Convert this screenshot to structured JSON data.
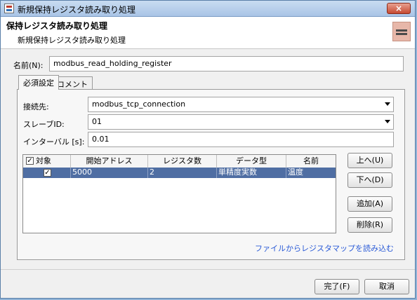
{
  "window": {
    "title": "新規保持レジスタ読み取り処理",
    "close_label": "×"
  },
  "header": {
    "title": "保持レジスタ読み取り処理",
    "subtitle": "新規保持レジスタ読み取り処理",
    "icon": "register-icon"
  },
  "name_field": {
    "label": "名前(N):",
    "value": "modbus_read_holding_register"
  },
  "tabs": [
    {
      "label": "必須設定",
      "selected": true
    },
    {
      "label": "コメント",
      "selected": false
    }
  ],
  "form": {
    "connection": {
      "label": "接続先:",
      "value": "modbus_tcp_connection"
    },
    "slave_id": {
      "label": "スレーブID:",
      "value": "01"
    },
    "interval": {
      "label": "インターバル [s]:",
      "value": "0.01"
    }
  },
  "table": {
    "columns": [
      "対象",
      "開始アドレス",
      "レジスタ数",
      "データ型",
      "名前"
    ],
    "header_checked": true,
    "rows": [
      {
        "checked": true,
        "start_address": "5000",
        "count": "2",
        "data_type": "単精度実数",
        "name": "温度"
      }
    ]
  },
  "side_buttons": {
    "up": "上へ(U)",
    "down": "下へ(D)",
    "add": "追加(A)",
    "delete": "削除(R)"
  },
  "load_link": "ファイルからレジスタマップを読み込む",
  "footer": {
    "finish": "完了(F)",
    "cancel": "取消"
  }
}
